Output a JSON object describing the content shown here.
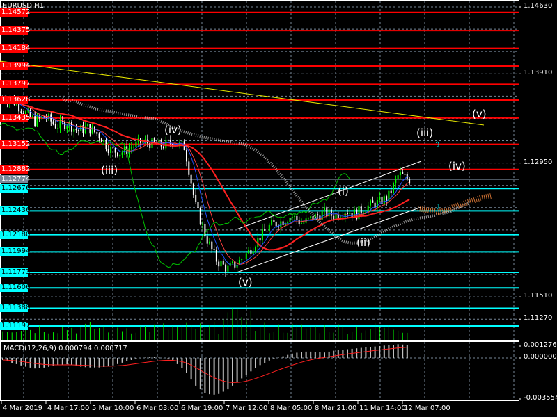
{
  "title": "EURUSD,H1",
  "macd_label": "MACD(12,26,9) 0.000794 0.000717",
  "colors": {
    "bull": "#00ff00",
    "bear": "#ffffff",
    "red_level": "#ff0000",
    "cyan_level": "#00ffff",
    "ma": "#ff2020",
    "chikou": "#00c000",
    "trend": "#e6e600"
  },
  "price_axis": [
    "1.14630",
    "1.13910",
    "1.12950",
    "1.11510",
    "1.11270"
  ],
  "red_levels": [
    "1.14572",
    "1.14375",
    "1.14184",
    "1.13994",
    "1.13797",
    "1.13628",
    "1.13435",
    "1.13152",
    "1.12882"
  ],
  "current_price": "1.12774",
  "cyan_levels": [
    "1.12676",
    "1.12436",
    "1.12180",
    "1.11994",
    "1.11773",
    "1.11606",
    "1.11388",
    "1.11197"
  ],
  "macd_axis": [
    "0.001276",
    "0.000000",
    "-0.003554"
  ],
  "time_axis": [
    "4 Mar 2019",
    "4 Mar 17:00",
    "5 Mar 10:00",
    "6 Mar 03:00",
    "6 Mar 19:00",
    "7 Mar 12:00",
    "8 Mar 05:00",
    "8 Mar 21:00",
    "11 Mar 14:00",
    "12 Mar 07:00"
  ],
  "waves": [
    "(v)",
    "(iii)",
    "(iv)",
    "(iii)",
    "(iv)",
    "(i)",
    "(ii)",
    "(v)"
  ],
  "chart_data": {
    "type": "candlestick",
    "symbol": "EURUSD",
    "timeframe": "H1",
    "close": [
      1.1365,
      1.1362,
      1.135,
      1.134,
      1.1345,
      1.1335,
      1.1338,
      1.133,
      1.1333,
      1.1325,
      1.131,
      1.1306,
      1.1312,
      1.1318,
      1.1316,
      1.1314,
      1.1318,
      1.1312,
      1.125,
      1.1215,
      1.119,
      1.1181,
      1.1188,
      1.12,
      1.1215,
      1.1228,
      1.1232,
      1.1238,
      1.123,
      1.1236,
      1.1242,
      1.1238,
      1.1244,
      1.124,
      1.1248,
      1.1252,
      1.1258,
      1.1283,
      1.1277
    ],
    "ylim": [
      1.1111,
      1.1463
    ],
    "macd_hist": [
      -0.0002,
      -0.0005,
      -0.0008,
      -0.001,
      -0.0009,
      -0.0007,
      -0.0006,
      -0.0008,
      -0.0009,
      -0.0009,
      -0.0008,
      -0.0005,
      -0.0002,
      0,
      0.0001,
      0,
      -0.0003,
      -0.0012,
      -0.0026,
      -0.0034,
      -0.0035,
      -0.003,
      -0.0022,
      -0.0014,
      -0.0007,
      -0.0002,
      0.0001,
      0.0004,
      0.0006,
      0.0006,
      0.0005,
      0.0007,
      0.0008,
      0.0009,
      0.001,
      0.0011,
      0.0012,
      0.0013,
      0.0012
    ],
    "macd_ylim": [
      -0.003554,
      0.001276
    ]
  }
}
